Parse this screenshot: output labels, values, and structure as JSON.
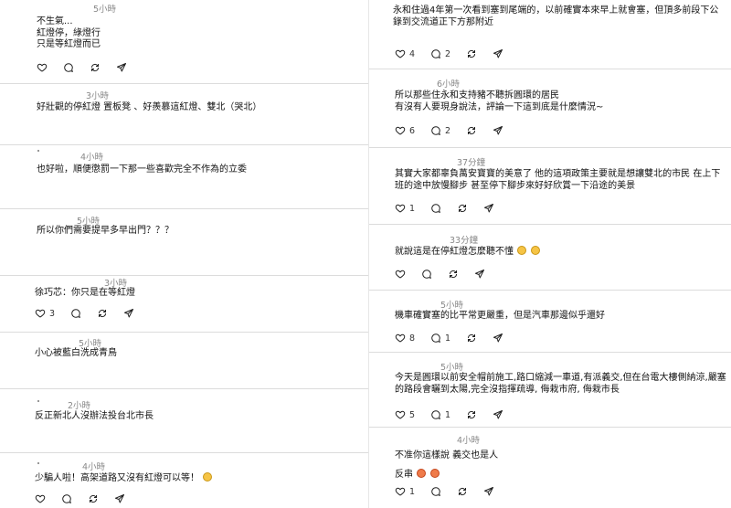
{
  "left": [
    {
      "time": "5小時",
      "lines": [
        "不生氣...",
        "紅燈停，綠燈行",
        "只是等紅燈而已"
      ]
    },
    {
      "time": "3小時",
      "lines": [
        "好壯觀的停紅燈 置板凳 、好羨慕這紅燈、雙北（哭北）"
      ]
    },
    {
      "time": "4小時",
      "lines": [
        "也好啦，順便懲罰一下那一些喜歡完全不作為的立委"
      ]
    },
    {
      "time": "5小時",
      "lines": [
        "所以你們需要提早多早出門？？？"
      ]
    },
    {
      "time": "3小時",
      "lines": [
        "徐巧芯：你只是在等紅燈"
      ],
      "likes": "3"
    },
    {
      "time": "5小時",
      "lines": [
        "小心被藍白洗成青鳥"
      ]
    },
    {
      "time": "2小時",
      "lines": [
        "反正新北人沒辦法投台北市長"
      ]
    },
    {
      "time": "4小時",
      "lines": [
        "少騙人啦！高架道路又沒有紅燈可以等！"
      ]
    }
  ],
  "right": [
    {
      "time": "",
      "lines": [
        "永和住過4年第一次看到塞到尾端的，以前確實本來早上就會塞，但頂多前段下公",
        "錄到交流道正下方那附近"
      ],
      "likes": "4",
      "comments": "2"
    },
    {
      "time": "6小時",
      "lines": [
        "所以那些住永和支持豬不聽拆圓環的居民",
        "有沒有人要現身說法，評論一下這到底是什麼情況~"
      ],
      "likes": "6",
      "comments": "2"
    },
    {
      "time": "37分鐘",
      "lines": [
        "其實大家都辜負萬安寶寶的美意了 他的這項政策主要就是想讓雙北的市民 在上下",
        "班的途中放慢腳步 甚至停下腳步來好好欣賞一下沿途的美景"
      ],
      "likes": "1"
    },
    {
      "time": "33分鐘",
      "lines": [
        "就說這是在停紅燈怎麼聽不懂"
      ]
    },
    {
      "time": "5小時",
      "lines": [
        "機車確實塞的比平常更嚴重，但是汽車那邊似乎還好"
      ],
      "likes": "8",
      "comments": "1"
    },
    {
      "time": "5小時",
      "lines": [
        "今天是圓環以前安全帽前施工,路口縮減一車道,有派義交,但在台電大樓側納涼,嚴塞",
        "的路段會曬到太陽,完全沒指揮疏導, 侮栽市府, 侮栽市長"
      ],
      "likes": "5",
      "comments": "1"
    },
    {
      "time": "4小時",
      "lines": [
        "不准你這樣說 義交也是人",
        "反串"
      ],
      "likes": "1"
    }
  ],
  "icons": [
    "heart-icon",
    "comment-icon",
    "repost-icon",
    "share-icon"
  ]
}
